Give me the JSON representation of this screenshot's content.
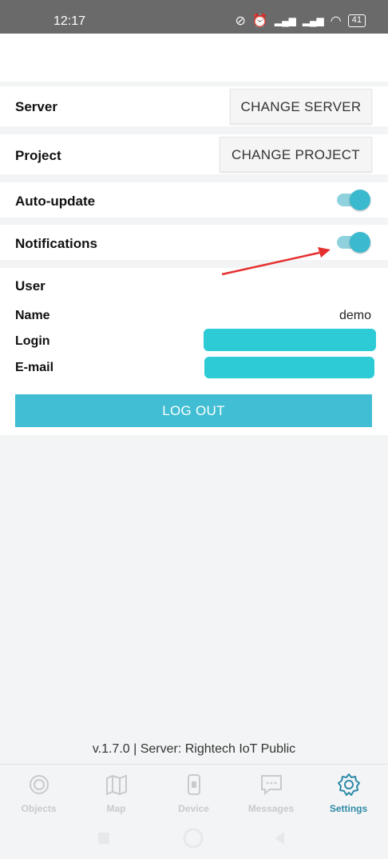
{
  "status_bar": {
    "time": "12:17",
    "battery": "41"
  },
  "settings": {
    "server": {
      "label": "Server",
      "button": "CHANGE SERVER"
    },
    "project": {
      "label": "Project",
      "button": "CHANGE PROJECT"
    },
    "auto_update": {
      "label": "Auto-update",
      "enabled": true
    },
    "notifications": {
      "label": "Notifications",
      "enabled": true
    }
  },
  "user": {
    "heading": "User",
    "name_label": "Name",
    "name_value": "demo",
    "login_label": "Login",
    "email_label": "E-mail",
    "logout_button": "LOG OUT"
  },
  "footer": {
    "version": "v.1.7.0 | Server: Rightech IoT Public"
  },
  "tabs": [
    {
      "label": "Objects",
      "icon": "objects-icon",
      "active": false
    },
    {
      "label": "Map",
      "icon": "map-icon",
      "active": false
    },
    {
      "label": "Device",
      "icon": "device-icon",
      "active": false
    },
    {
      "label": "Messages",
      "icon": "messages-icon",
      "active": false
    },
    {
      "label": "Settings",
      "icon": "gear-icon",
      "active": true
    }
  ],
  "colors": {
    "accent": "#3bb9cf",
    "logout": "#41bed3",
    "tab_active": "#2e8aa8",
    "annotation_arrow": "#e53030"
  }
}
